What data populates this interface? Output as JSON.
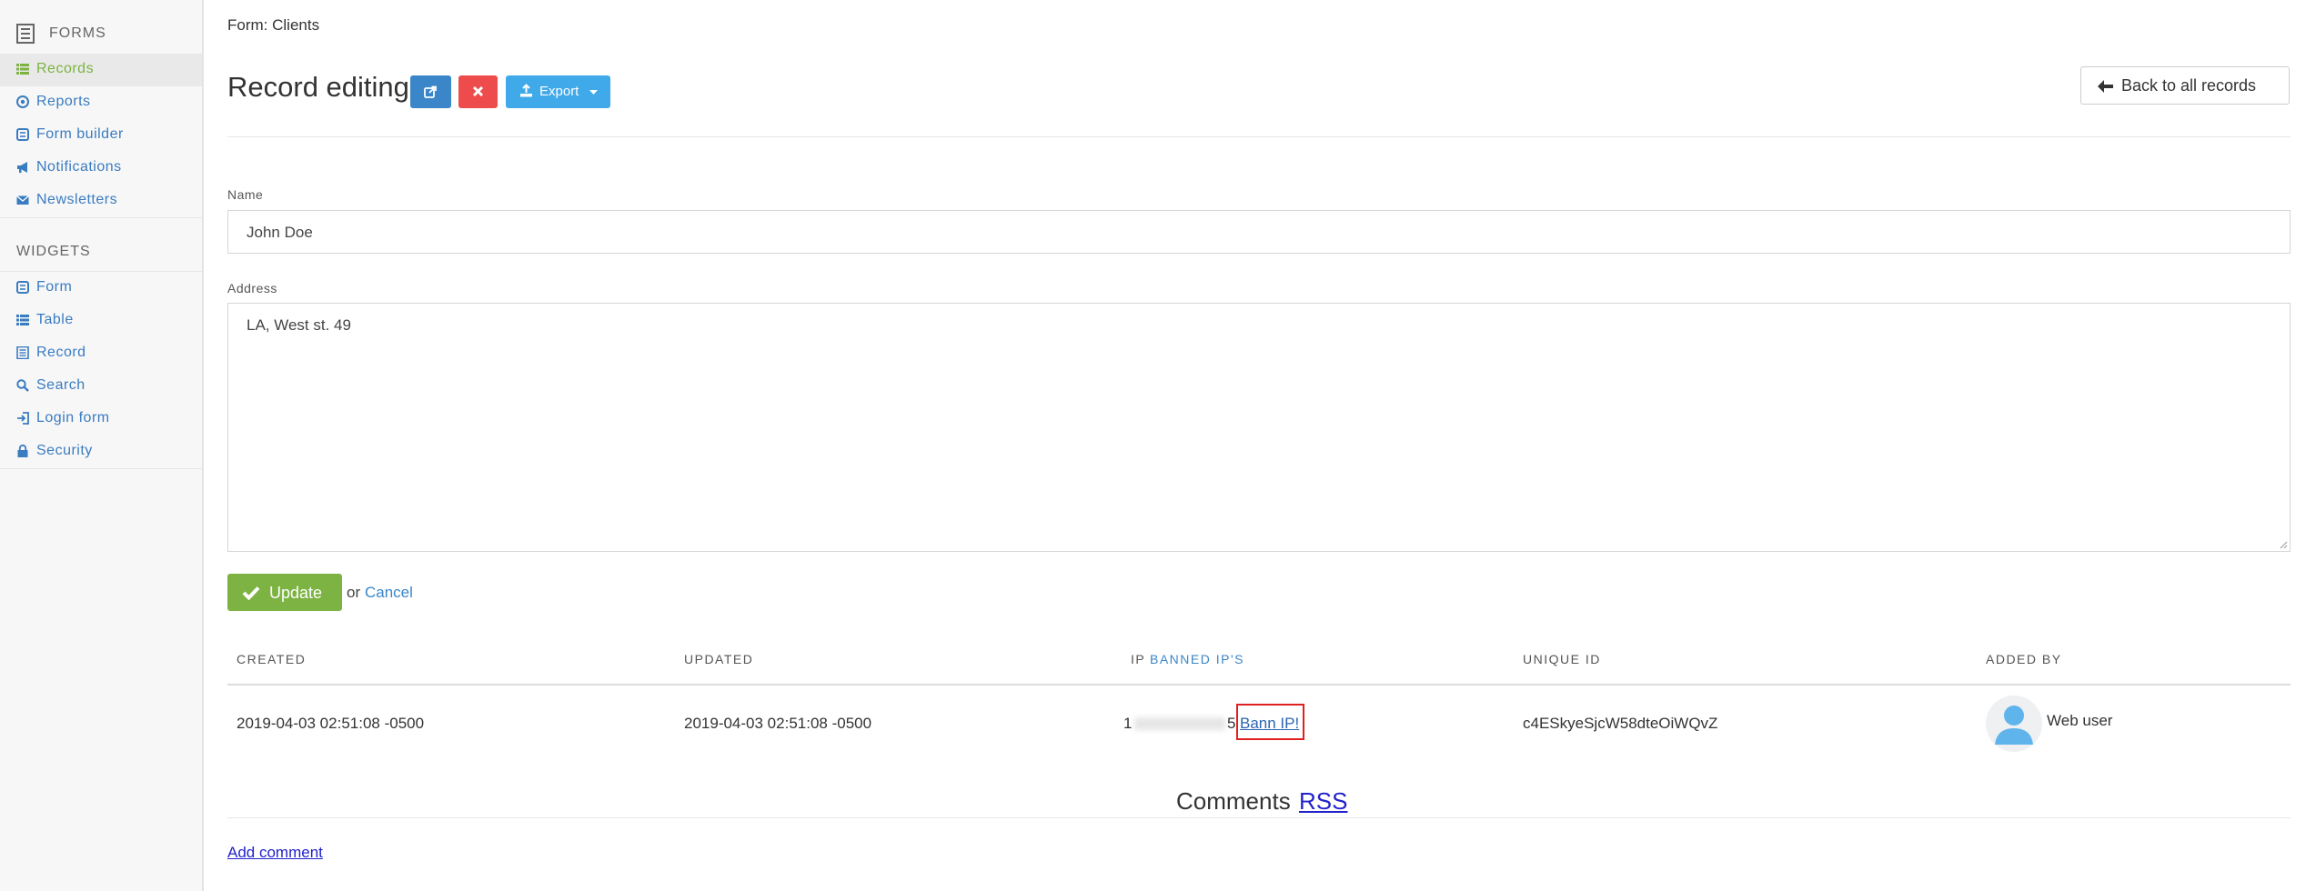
{
  "sidebar": {
    "forms_header": "FORMS",
    "forms_items": [
      {
        "label": "Records",
        "icon": "list-icon",
        "active": true
      },
      {
        "label": "Reports",
        "icon": "target-icon"
      },
      {
        "label": "Form builder",
        "icon": "form-icon"
      },
      {
        "label": "Notifications",
        "icon": "megaphone-icon"
      },
      {
        "label": "Newsletters",
        "icon": "envelope-icon"
      }
    ],
    "widgets_header": "WIDGETS",
    "widgets_items": [
      {
        "label": "Form",
        "icon": "form-icon"
      },
      {
        "label": "Table",
        "icon": "list-icon"
      },
      {
        "label": "Record",
        "icon": "document-icon"
      },
      {
        "label": "Search",
        "icon": "search-icon"
      },
      {
        "label": "Login form",
        "icon": "sign-in-icon"
      },
      {
        "label": "Security",
        "icon": "lock-icon"
      }
    ]
  },
  "breadcrumb": "Form: Clients",
  "page_title": "Record editing",
  "toolbar": {
    "export_label": "Export",
    "back_label": "Back to all records"
  },
  "form": {
    "name_label": "Name",
    "name_value": "John Doe",
    "address_label": "Address",
    "address_value": "LA, West st. 49",
    "update_label": "Update",
    "or_text": "or",
    "cancel_label": "Cancel"
  },
  "meta_table": {
    "headers": {
      "created": "CREATED",
      "updated": "UPDATED",
      "ip": "IP",
      "banned": "BANNED IP'S",
      "unique_id": "UNIQUE ID",
      "added_by": "ADDED BY"
    },
    "row": {
      "created": "2019-04-03 02:51:08 -0500",
      "updated": "2019-04-03 02:51:08 -0500",
      "ip_start": "1",
      "ip_end": "5",
      "ban_label": "Bann IP!",
      "unique_id": "c4ESkyeSjcW58dteOiWQvZ",
      "added_by": "Web user"
    }
  },
  "comments": {
    "title": "Comments",
    "rss_label": "RSS",
    "add_label": "Add comment"
  },
  "colors": {
    "accent_green": "#7cb342",
    "link_blue": "#3a86c8",
    "danger": "#ee4c4c",
    "export": "#40a9e9"
  }
}
